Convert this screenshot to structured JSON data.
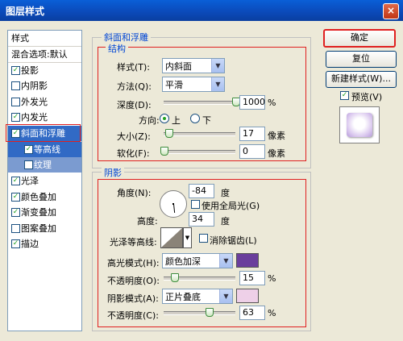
{
  "window": {
    "title": "图层样式",
    "close_label": "×"
  },
  "sidebar": {
    "header": "样式",
    "blend": "混合选项:默认",
    "items": [
      {
        "label": "投影",
        "checked": "✓"
      },
      {
        "label": "内阴影",
        "checked": ""
      },
      {
        "label": "外发光",
        "checked": ""
      },
      {
        "label": "内发光",
        "checked": "✓"
      },
      {
        "label": "斜面和浮雕",
        "checked": "✓"
      },
      {
        "label": "等高线",
        "checked": "✓"
      },
      {
        "label": "纹理",
        "checked": ""
      },
      {
        "label": "光泽",
        "checked": "✓"
      },
      {
        "label": "颜色叠加",
        "checked": "✓"
      },
      {
        "label": "渐变叠加",
        "checked": "✓"
      },
      {
        "label": "图案叠加",
        "checked": ""
      },
      {
        "label": "描边",
        "checked": "✓"
      }
    ]
  },
  "bevel": {
    "section_title": "斜面和浮雕",
    "structure_title": "结构",
    "style_label": "样式(T):",
    "style_value": "内斜面",
    "method_label": "方法(Q):",
    "method_value": "平滑",
    "depth_label": "深度(D):",
    "depth_value": "1000",
    "depth_unit": "%",
    "depth_fill": 1.0,
    "direction_label": "方向:",
    "dir_up": "上",
    "dir_down": "下",
    "size_label": "大小(Z):",
    "size_value": "17",
    "size_unit": "像素",
    "size_fill": 0.07,
    "soften_label": "软化(F):",
    "soften_value": "0",
    "soften_unit": "像素",
    "soften_fill": 0.0
  },
  "shading": {
    "section_title": "阴影",
    "angle_label": "角度(N):",
    "angle_value": "-84",
    "angle_unit": "度",
    "global_light_label": "使用全局光(G)",
    "altitude_label": "高度:",
    "altitude_value": "34",
    "altitude_unit": "度",
    "gloss_label": "光泽等高线:",
    "antialias_label": "消除锯齿(L)",
    "highlight_label": "高光模式(H):",
    "highlight_mode": "颜色加深",
    "highlight_color": "#6a3e9c",
    "hl_opacity_label": "不透明度(O):",
    "hl_opacity_value": "15",
    "hl_opacity_unit": "%",
    "hl_opacity_fill": 0.15,
    "shadow_label": "阴影模式(A):",
    "shadow_mode": "正片叠底",
    "shadow_color": "#eed0e8",
    "sh_opacity_label": "不透明度(C):",
    "sh_opacity_value": "63",
    "sh_opacity_unit": "%",
    "sh_opacity_fill": 0.63
  },
  "buttons": {
    "ok": "确定",
    "reset": "复位",
    "new_style": "新建样式(W)...",
    "preview": "预览(V)",
    "preview_checked": "✓"
  }
}
